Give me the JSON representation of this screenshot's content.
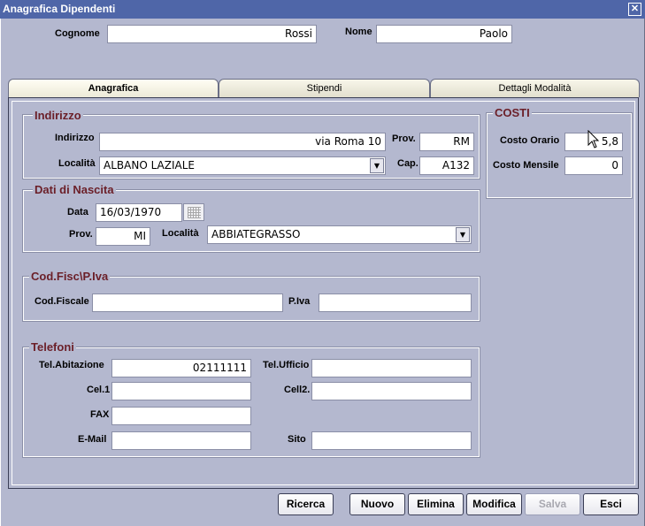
{
  "window": {
    "title": "Anagrafica Dipendenti",
    "close": "✕"
  },
  "header": {
    "cognome_label": "Cognome",
    "cognome_value": "Rossi",
    "nome_label": "Nome",
    "nome_value": "Paolo"
  },
  "tabs": [
    {
      "label": "Anagrafica",
      "active": true
    },
    {
      "label": "Stipendi",
      "active": false
    },
    {
      "label": "Dettagli Modalità",
      "active": false
    }
  ],
  "indirizzo": {
    "title": "Indirizzo",
    "indirizzo_label": "Indirizzo",
    "indirizzo_value": "via Roma 10",
    "prov_label": "Prov.",
    "prov_value": "RM",
    "localita_label": "Località",
    "localita_value": "ALBANO LAZIALE",
    "cap_label": "Cap.",
    "cap_value": "A132"
  },
  "costi": {
    "title": "COSTI",
    "orario_label": "Costo Orario",
    "orario_value": "5,8",
    "mensile_label": "Costo Mensile",
    "mensile_value": "0"
  },
  "nascita": {
    "title": "Dati di Nascita",
    "data_label": "Data",
    "data_value": "16/03/1970",
    "prov_label": "Prov.",
    "prov_value": "MI",
    "localita_label": "Località",
    "localita_value": "ABBIATEGRASSO"
  },
  "codfisc": {
    "title": "Cod.Fisc\\P.Iva",
    "cf_label": "Cod.Fiscale",
    "cf_value": "",
    "piva_label": "P.Iva",
    "piva_value": ""
  },
  "telefoni": {
    "title": "Telefoni",
    "abit_label": "Tel.Abitazione",
    "abit_value": "02111111",
    "uff_label": "Tel.Ufficio",
    "uff_value": "",
    "cel1_label": "Cel.1",
    "cel1_value": "",
    "cel2_label": "Cell2.",
    "cel2_value": "",
    "fax_label": "FAX",
    "fax_value": "",
    "email_label": "E-Mail",
    "email_value": "",
    "sito_label": "Sito",
    "sito_value": ""
  },
  "buttons": {
    "ricerca": "Ricerca",
    "nuovo": "Nuovo",
    "elimina": "Elimina",
    "modifica": "Modifica",
    "salva": "Salva",
    "esci": "Esci"
  },
  "icons": {
    "combo_arrow": "▼",
    "calendar": "calendar-icon"
  }
}
